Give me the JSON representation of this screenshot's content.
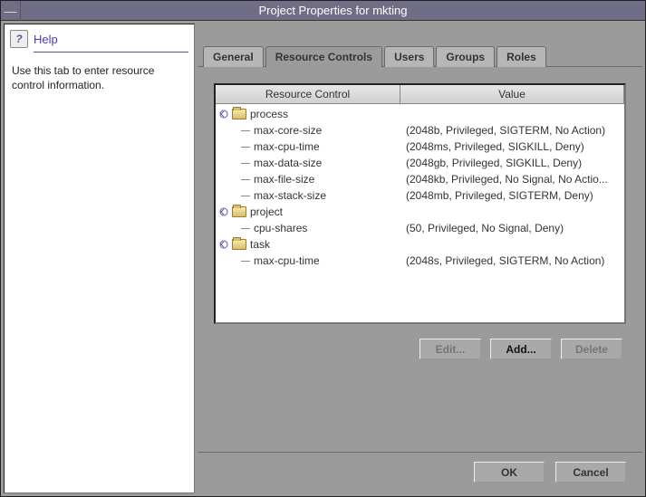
{
  "window": {
    "title": "Project Properties for mkting"
  },
  "help": {
    "title": "Help",
    "body": "Use this tab to enter resource control information."
  },
  "tabs": {
    "items": [
      {
        "label": "General"
      },
      {
        "label": "Resource Controls"
      },
      {
        "label": "Users"
      },
      {
        "label": "Groups"
      },
      {
        "label": "Roles"
      }
    ],
    "active_index": 1
  },
  "columns": {
    "name": "Resource Control",
    "value": "Value"
  },
  "tree": [
    {
      "type": "cat",
      "label": "process"
    },
    {
      "type": "leaf",
      "label": "max-core-size",
      "value": "(2048b, Privileged, SIGTERM, No Action)"
    },
    {
      "type": "leaf",
      "label": "max-cpu-time",
      "value": "(2048ms, Privileged, SIGKILL, Deny)"
    },
    {
      "type": "leaf",
      "label": "max-data-size",
      "value": "(2048gb, Privileged, SIGKILL, Deny)"
    },
    {
      "type": "leaf",
      "label": "max-file-size",
      "value": "(2048kb, Privileged, No Signal, No Actio..."
    },
    {
      "type": "leaf",
      "label": "max-stack-size",
      "value": "(2048mb, Privileged, SIGTERM, Deny)"
    },
    {
      "type": "cat",
      "label": "project"
    },
    {
      "type": "leaf",
      "label": "cpu-shares",
      "value": "(50, Privileged, No Signal, Deny)"
    },
    {
      "type": "cat",
      "label": "task"
    },
    {
      "type": "leaf",
      "label": "max-cpu-time",
      "value": "(2048s, Privileged, SIGTERM, No Action)"
    }
  ],
  "buttons": {
    "edit": "Edit...",
    "add": "Add...",
    "delete": "Delete"
  },
  "footer": {
    "ok": "OK",
    "cancel": "Cancel"
  }
}
